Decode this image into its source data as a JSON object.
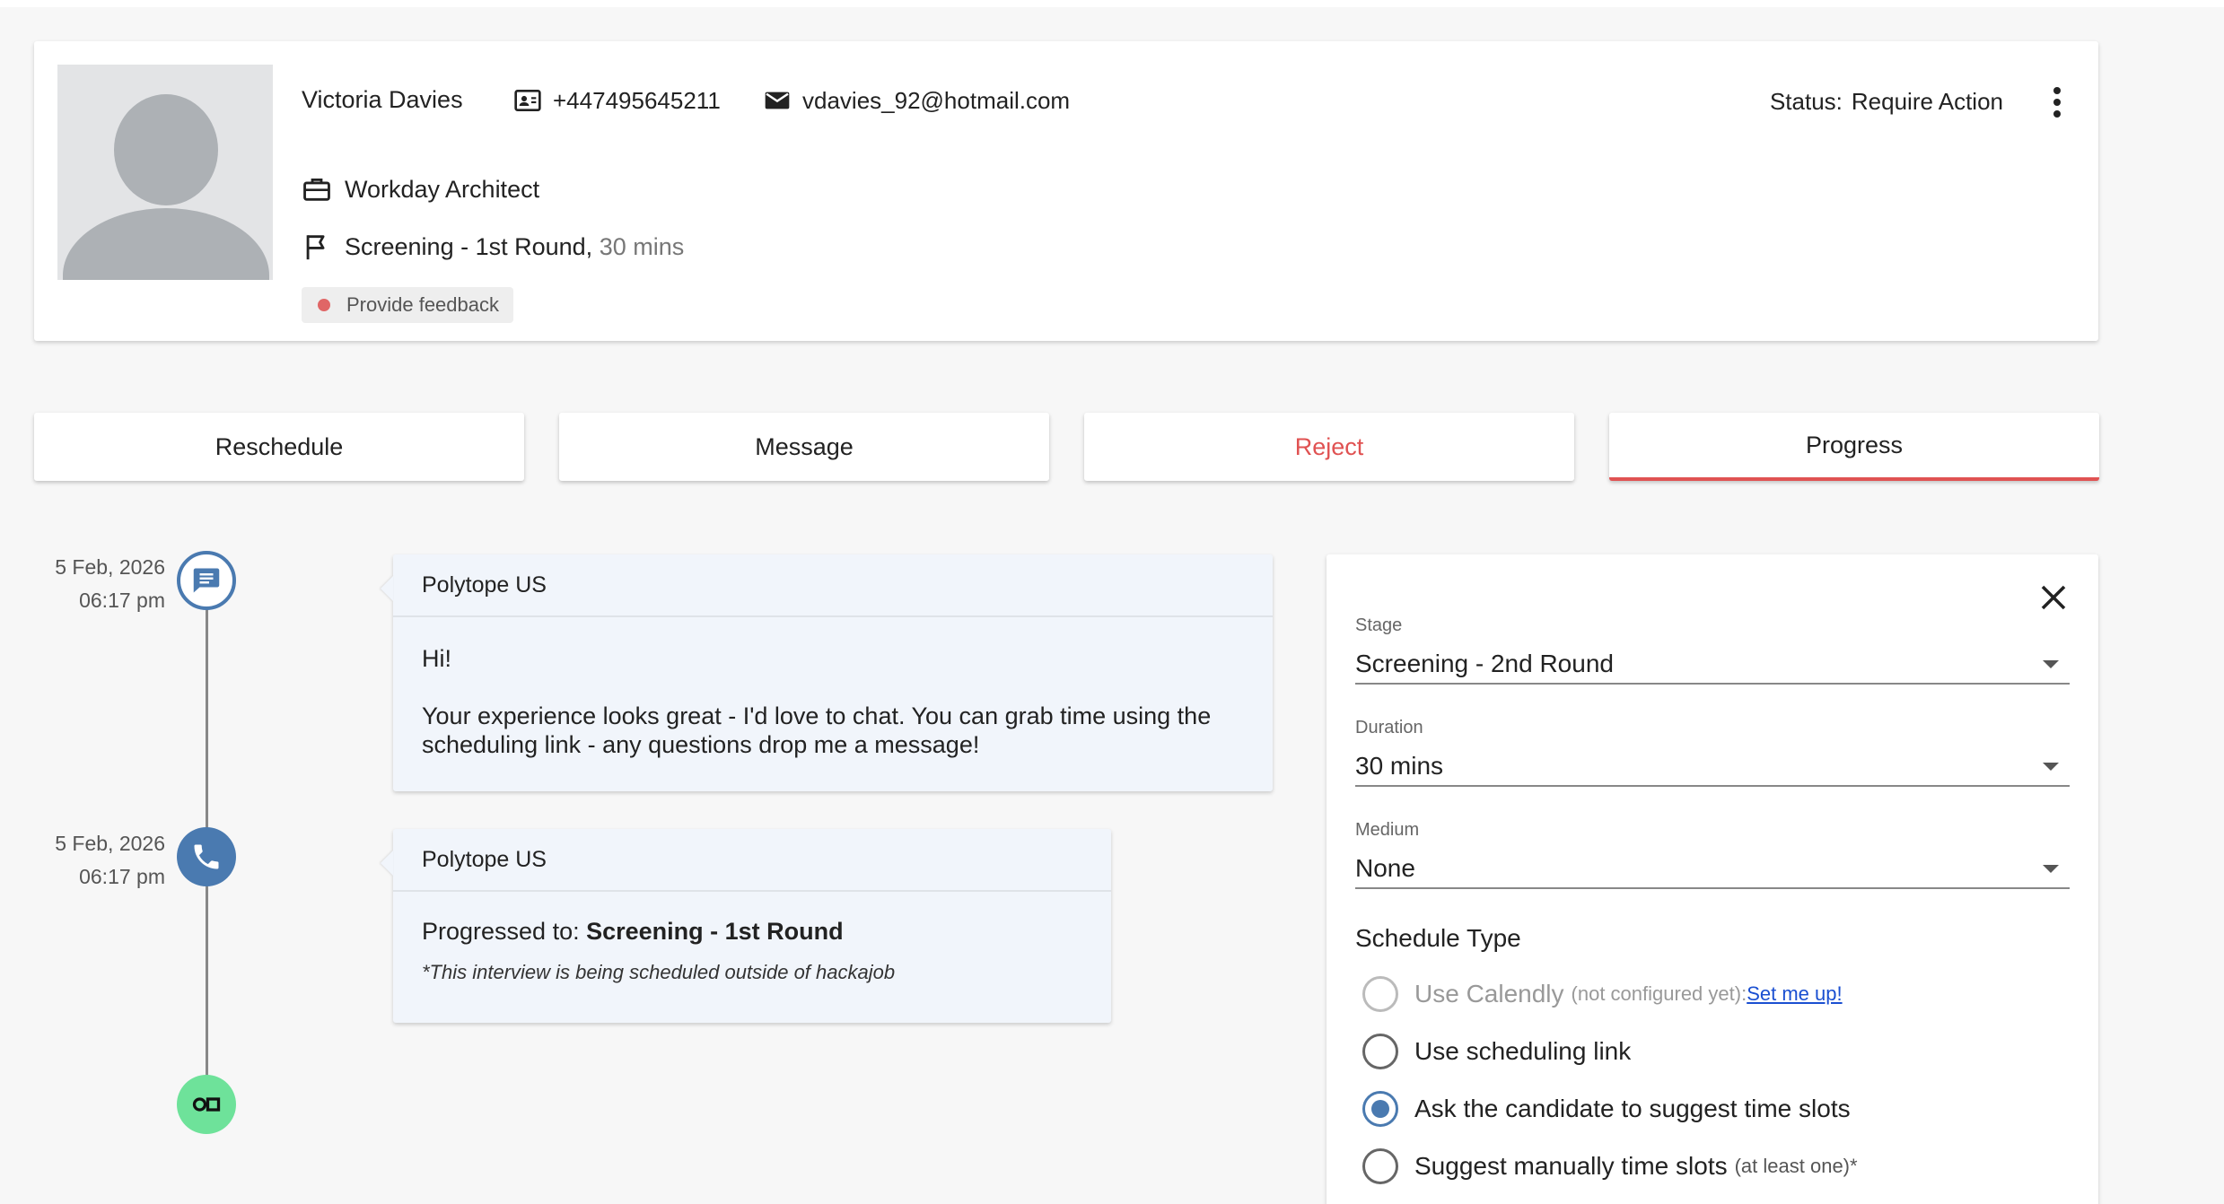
{
  "candidate": {
    "name": "Victoria Davies",
    "phone": "+447495645211",
    "email": "vdavies_92@hotmail.com",
    "job_title": "Workday Architect",
    "stage": "Screening - 1st Round,",
    "stage_duration": "30 mins",
    "feedback_chip": "Provide feedback",
    "status_label": "Status:",
    "status_value": "Require Action"
  },
  "actions": {
    "reschedule": "Reschedule",
    "message": "Message",
    "reject": "Reject",
    "progress": "Progress"
  },
  "timeline": [
    {
      "date": "5 Feb, 2026",
      "time": "06:17 pm",
      "sender": "Polytope US",
      "greeting": "Hi!",
      "text": "Your experience looks great - I'd love to chat. You can grab time using the scheduling link - any questions drop me a message!"
    },
    {
      "date": "5 Feb, 2026",
      "time": "06:17 pm",
      "sender": "Polytope US",
      "progress_prefix": "Progressed to:",
      "progress_stage": "Screening - 1st Round",
      "note": "*This interview is being scheduled outside of hackajob"
    }
  ],
  "form": {
    "stage_label": "Stage",
    "stage_value": "Screening - 2nd Round",
    "duration_label": "Duration",
    "duration_value": "30 mins",
    "medium_label": "Medium",
    "medium_value": "None",
    "schedule_type_label": "Schedule Type",
    "options": [
      {
        "label": "Use Calendly",
        "hint": "(not configured yet):",
        "link": "Set me up!"
      },
      {
        "label": "Use scheduling link"
      },
      {
        "label": "Ask the candidate to suggest time slots"
      },
      {
        "label": "Suggest manually time slots",
        "hint": "(at least one)*"
      }
    ]
  },
  "colors": {
    "accent_blue": "#4a7ab0",
    "reject_red": "#e05252",
    "node_green": "#6ee29a",
    "feedback_dot": "#e06666"
  }
}
